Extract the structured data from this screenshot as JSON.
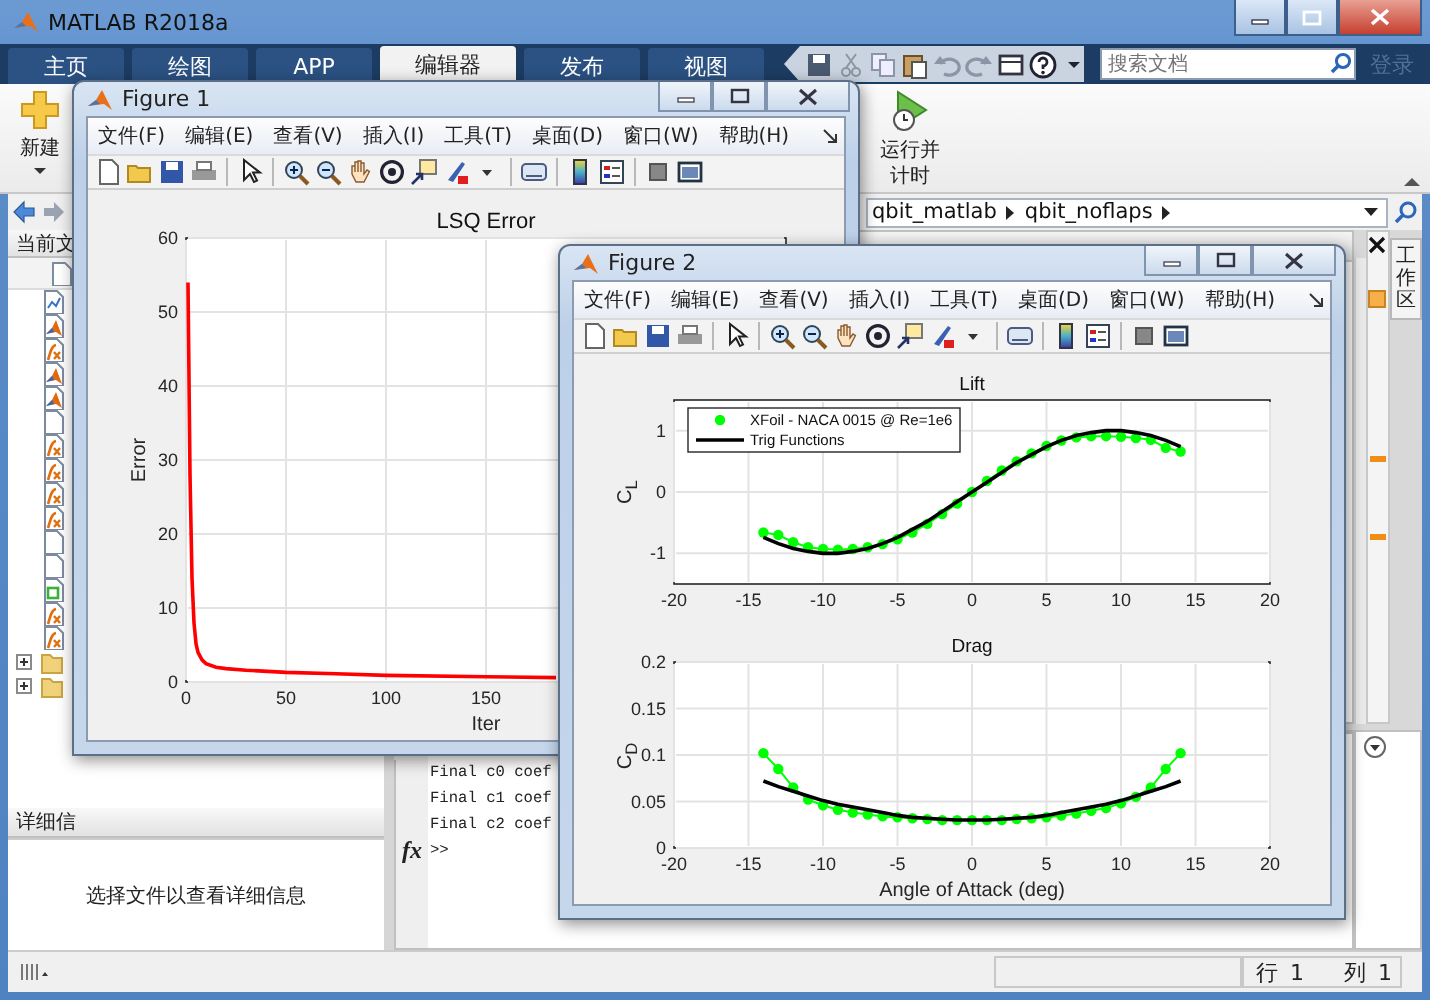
{
  "window": {
    "title": "MATLAB R2018a"
  },
  "tabs": [
    {
      "label": "主页",
      "selected": false
    },
    {
      "label": "绘图",
      "selected": false
    },
    {
      "label": "APP",
      "selected": false
    },
    {
      "label": "编辑器",
      "selected": true
    },
    {
      "label": "发布",
      "selected": false
    },
    {
      "label": "视图",
      "selected": false
    }
  ],
  "search": {
    "placeholder": "搜索文档"
  },
  "sign_in": "登录",
  "ribbon": {
    "new_button": "新建",
    "run_and_time_button": "运行并计时"
  },
  "address_bar": {
    "crumbs": [
      "qbit_matlab",
      "qbit_noflaps"
    ]
  },
  "current_folder": {
    "title": "当前文",
    "files": [
      {
        "kind": "figure"
      },
      {
        "kind": "live_script"
      },
      {
        "kind": "function"
      },
      {
        "kind": "live_script"
      },
      {
        "kind": "live_script"
      },
      {
        "kind": "blank"
      },
      {
        "kind": "function"
      },
      {
        "kind": "function"
      },
      {
        "kind": "function"
      },
      {
        "kind": "function"
      },
      {
        "kind": "blank"
      },
      {
        "kind": "blank"
      },
      {
        "kind": "data"
      },
      {
        "kind": "function"
      },
      {
        "kind": "function"
      },
      {
        "kind": "folder",
        "expanded": false
      },
      {
        "kind": "folder",
        "expanded": false
      }
    ]
  },
  "details": {
    "title": "详细信",
    "message": "选择文件以查看详细信息"
  },
  "command_window": {
    "lines": [
      "Final c0 coef",
      "Final c1 coef",
      "Final c2 coef"
    ],
    "function_button": "fx",
    "prompt": ">>"
  },
  "workspace": {
    "title": "工作区"
  },
  "status_bar": {
    "row_label": "行",
    "row": "1",
    "column_label": "列",
    "column": "1"
  },
  "figures": [
    {
      "title": "Figure 1",
      "menu": [
        "文件(F)",
        "编辑(E)",
        "查看(V)",
        "插入(I)",
        "工具(T)",
        "桌面(D)",
        "窗口(W)",
        "帮助(H)"
      ],
      "axes": [
        {
          "chart_data": {
            "type": "line",
            "title": "LSQ Error",
            "xlabel": "Iter",
            "ylabel": "Error",
            "x": [
              1,
              2,
              3,
              4,
              5,
              6,
              8,
              10,
              15,
              20,
              30,
              50,
              75,
              100,
              150,
              185
            ],
            "grid": true,
            "xlim": [
              0,
              300
            ],
            "ylim": [
              0,
              60
            ],
            "xticks": [
              0,
              50,
              100,
              150
            ],
            "yticks": [
              0,
              10,
              20,
              30,
              40,
              50,
              60
            ],
            "series": [
              {
                "color": "#ff0000",
                "values": [
                  54,
                  28,
                  14,
                  8,
                  5.2,
                  4,
                  3,
                  2.5,
                  2,
                  1.8,
                  1.6,
                  1.3,
                  1.1,
                  0.9,
                  0.7,
                  0.6
                ]
              }
            ]
          }
        }
      ]
    },
    {
      "title": "Figure 2",
      "menu": [
        "文件(F)",
        "编辑(E)",
        "查看(V)",
        "插入(I)",
        "工具(T)",
        "桌面(D)",
        "窗口(W)",
        "帮助(H)"
      ],
      "axes": [
        {
          "chart_data": {
            "type": "line",
            "title": "Lift",
            "ylabel": "C$_{L}$",
            "x": [
              -14,
              -13,
              -12,
              -11,
              -10,
              -9,
              -8,
              -7,
              -6,
              -5,
              -4,
              -3,
              -2,
              -1,
              0,
              1,
              2,
              3,
              4,
              5,
              6,
              7,
              8,
              9,
              10,
              11,
              12,
              13,
              14
            ],
            "grid": true,
            "legend": "upper left",
            "xlim": [
              -20,
              20
            ],
            "ylim": [
              -1.5,
              1.5
            ],
            "xticks": [
              -20,
              -15,
              -10,
              -5,
              0,
              5,
              10,
              15,
              20
            ],
            "yticks": [
              -1,
              0,
              1
            ],
            "series": [
              {
                "name": "XFoil - NACA 0015 @ Re=1e6",
                "color": "#00ff00",
                "marker": "circle",
                "values": [
                  -0.66,
                  -0.7,
                  -0.82,
                  -0.9,
                  -0.93,
                  -0.94,
                  -0.93,
                  -0.9,
                  -0.85,
                  -0.77,
                  -0.66,
                  -0.52,
                  -0.36,
                  -0.19,
                  0,
                  0.18,
                  0.35,
                  0.5,
                  0.63,
                  0.75,
                  0.84,
                  0.89,
                  0.91,
                  0.91,
                  0.9,
                  0.88,
                  0.85,
                  0.72,
                  0.66
                ]
              },
              {
                "name": "Trig Functions",
                "color": "#000000",
                "values": [
                  -0.74,
                  -0.84,
                  -0.92,
                  -0.97,
                  -1.0,
                  -1.0,
                  -0.97,
                  -0.92,
                  -0.84,
                  -0.74,
                  -0.61,
                  -0.48,
                  -0.32,
                  -0.16,
                  0,
                  0.16,
                  0.32,
                  0.48,
                  0.61,
                  0.74,
                  0.84,
                  0.92,
                  0.97,
                  1.0,
                  1.0,
                  0.97,
                  0.92,
                  0.84,
                  0.74
                ]
              }
            ]
          }
        },
        {
          "chart_data": {
            "type": "line",
            "title": "Drag",
            "xlabel": "Angle of Attack (deg)",
            "ylabel": "C$_{D}$",
            "x": [
              -14,
              -13,
              -12,
              -11,
              -10,
              -9,
              -8,
              -7,
              -6,
              -5,
              -4,
              -3,
              -2,
              -1,
              0,
              1,
              2,
              3,
              4,
              5,
              6,
              7,
              8,
              9,
              10,
              11,
              12,
              13,
              14
            ],
            "grid": true,
            "xlim": [
              -20,
              20
            ],
            "ylim": [
              0,
              0.2
            ],
            "xticks": [
              -20,
              -15,
              -10,
              -5,
              0,
              5,
              10,
              15,
              20
            ],
            "yticks": [
              0,
              0.05,
              0.1,
              0.15,
              0.2
            ],
            "series": [
              {
                "color": "#00ff00",
                "marker": "circle",
                "values": [
                  0.102,
                  0.085,
                  0.065,
                  0.052,
                  0.046,
                  0.041,
                  0.038,
                  0.036,
                  0.034,
                  0.033,
                  0.032,
                  0.031,
                  0.03,
                  0.03,
                  0.03,
                  0.03,
                  0.03,
                  0.031,
                  0.032,
                  0.033,
                  0.035,
                  0.037,
                  0.04,
                  0.043,
                  0.048,
                  0.055,
                  0.065,
                  0.085,
                  0.102
                ]
              },
              {
                "color": "#000000",
                "values": [
                  0.072,
                  0.066,
                  0.061,
                  0.056,
                  0.051,
                  0.047,
                  0.044,
                  0.041,
                  0.038,
                  0.035,
                  0.033,
                  0.032,
                  0.031,
                  0.03,
                  0.03,
                  0.03,
                  0.031,
                  0.032,
                  0.033,
                  0.035,
                  0.038,
                  0.041,
                  0.044,
                  0.047,
                  0.051,
                  0.056,
                  0.061,
                  0.066,
                  0.072
                ]
              }
            ]
          }
        }
      ]
    }
  ]
}
